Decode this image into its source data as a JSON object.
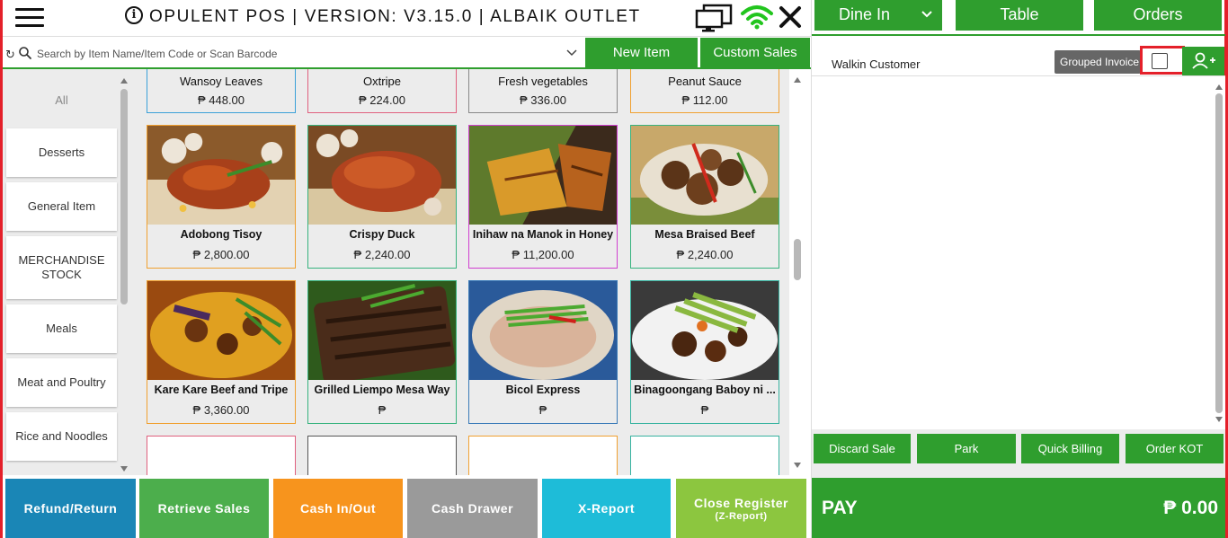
{
  "header": {
    "title": "OPULENT POS | VERSION: V3.15.0 | ALBAIK OUTLET"
  },
  "search": {
    "placeholder": "Search by Item Name/Item Code or Scan Barcode",
    "new_item_label": "New Item",
    "custom_sales_label": "Custom Sales"
  },
  "categories": [
    {
      "label": "All"
    },
    {
      "label": "Desserts"
    },
    {
      "label": "General Item"
    },
    {
      "label": "MERCHANDISE STOCK"
    },
    {
      "label": "Meals"
    },
    {
      "label": "Meat and Poultry"
    },
    {
      "label": "Rice and Noodles"
    }
  ],
  "items": [
    {
      "name": "Wansoy Leaves",
      "price": "₱ 448.00",
      "border": "#3aa0d8"
    },
    {
      "name": "Oxtripe",
      "price": "₱ 224.00",
      "border": "#e0607e"
    },
    {
      "name": "Fresh vegetables",
      "price": "₱ 336.00",
      "border": "#888888"
    },
    {
      "name": "Peanut Sauce",
      "price": "₱ 112.00",
      "border": "#f0a030"
    },
    {
      "name": "Adobong Tisoy",
      "price": "₱ 2,800.00",
      "border": "#f0a030"
    },
    {
      "name": "Crispy Duck",
      "price": "₱ 2,240.00",
      "border": "#37b37e"
    },
    {
      "name": "Inihaw na Manok in Honey",
      "price": "₱ 11,200.00",
      "border": "#d040d0"
    },
    {
      "name": "Mesa Braised Beef",
      "price": "₱ 2,240.00",
      "border": "#37b37e"
    },
    {
      "name": "Kare Kare Beef and Tripe",
      "price": "₱ 3,360.00",
      "border": "#f0a030"
    },
    {
      "name": "Grilled Liempo Mesa Way",
      "price": "₱",
      "border": "#37b37e"
    },
    {
      "name": "Bicol Express",
      "price": "₱",
      "border": "#3a7ab8"
    },
    {
      "name": "Binagoongang Baboy ni ...",
      "price": "₱",
      "border": "#37b3a0"
    }
  ],
  "actions": [
    {
      "label": "Refund/Return",
      "sub": "",
      "color": "#1a86b6"
    },
    {
      "label": "Retrieve Sales",
      "sub": "",
      "color": "#4cae4c"
    },
    {
      "label": "Cash In/Out",
      "sub": "",
      "color": "#f7941d"
    },
    {
      "label": "Cash Drawer",
      "sub": "",
      "color": "#9a9a9a"
    },
    {
      "label": "X-Report",
      "sub": "",
      "color": "#1ebcd8"
    },
    {
      "label": "Close Register",
      "sub": "(Z-Report)",
      "color": "#8cc63f"
    }
  ],
  "order": {
    "dine_in_label": "Dine In",
    "table_label": "Table",
    "orders_label": "Orders",
    "customer": "Walkin Customer",
    "grouped_invoice_label": "Grouped Invoice",
    "discard_label": "Discard Sale",
    "park_label": "Park",
    "quick_billing_label": "Quick Billing",
    "order_kot_label": "Order KOT",
    "pay_label": "PAY",
    "pay_amount": "₱ 0.00"
  },
  "colors": {
    "primary_green": "#2f9e2e",
    "highlight_red": "#e4202a"
  }
}
